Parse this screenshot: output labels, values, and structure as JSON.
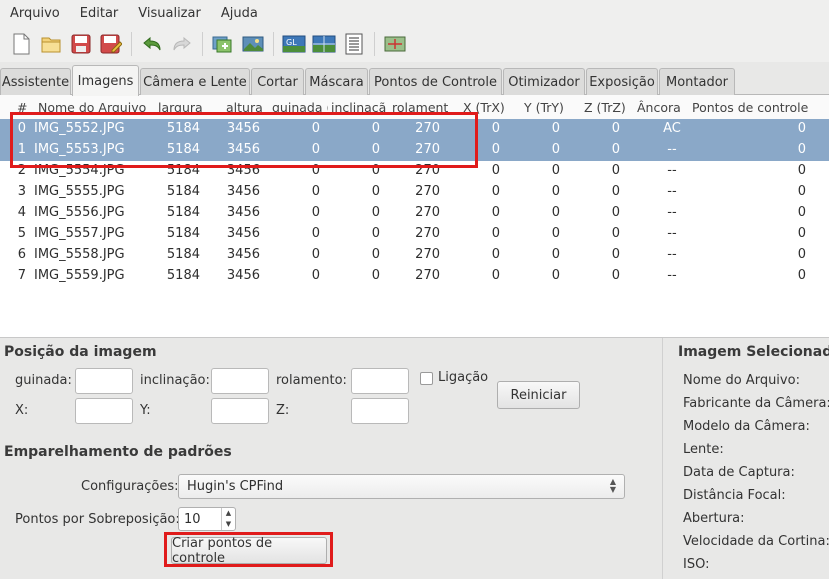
{
  "menu": [
    "Arquivo",
    "Editar",
    "Visualizar",
    "Ajuda"
  ],
  "toolbar_icons": [
    "new-file-icon",
    "open-folder-icon",
    "save-icon",
    "save-as-icon",
    "undo-icon",
    "redo-icon",
    "add-images-icon",
    "add-time-series-icon",
    "opengl-preview-icon",
    "fast-preview-icon",
    "list-view-icon",
    "control-point-editor-icon"
  ],
  "tabs": [
    "Assistente",
    "Imagens",
    "Câmera e Lente",
    "Cortar",
    "Máscara",
    "Pontos de Controle",
    "Otimizador",
    "Exposição",
    "Montador"
  ],
  "active_tab": "Imagens",
  "table": {
    "headers": [
      "#",
      "Nome do Arquivo",
      "largura",
      "altura",
      "guinada (",
      "inclinação",
      "rolament",
      "X (TrX)",
      "Y (TrY)",
      "Z (TrZ)",
      "Âncora",
      "Pontos de controle"
    ],
    "rows": [
      [
        "0",
        "IMG_5552.JPG",
        "5184",
        "3456",
        "0",
        "0",
        "270",
        "0",
        "0",
        "0",
        "AC",
        "0"
      ],
      [
        "1",
        "IMG_5553.JPG",
        "5184",
        "3456",
        "0",
        "0",
        "270",
        "0",
        "0",
        "0",
        "--",
        "0"
      ],
      [
        "2",
        "IMG_5554.JPG",
        "5184",
        "3456",
        "0",
        "0",
        "270",
        "0",
        "0",
        "0",
        "--",
        "0"
      ],
      [
        "3",
        "IMG_5555.JPG",
        "5184",
        "3456",
        "0",
        "0",
        "270",
        "0",
        "0",
        "0",
        "--",
        "0"
      ],
      [
        "4",
        "IMG_5556.JPG",
        "5184",
        "3456",
        "0",
        "0",
        "270",
        "0",
        "0",
        "0",
        "--",
        "0"
      ],
      [
        "5",
        "IMG_5557.JPG",
        "5184",
        "3456",
        "0",
        "0",
        "270",
        "0",
        "0",
        "0",
        "--",
        "0"
      ],
      [
        "6",
        "IMG_5558.JPG",
        "5184",
        "3456",
        "0",
        "0",
        "270",
        "0",
        "0",
        "0",
        "--",
        "0"
      ],
      [
        "7",
        "IMG_5559.JPG",
        "5184",
        "3456",
        "0",
        "0",
        "270",
        "0",
        "0",
        "0",
        "--",
        "0"
      ]
    ],
    "selected_rows": [
      0,
      1
    ]
  },
  "position": {
    "title": "Posição da imagem",
    "yaw_label": "guinada:",
    "pitch_label": "inclinação:",
    "roll_label": "rolamento:",
    "link_label": "Ligação",
    "x_label": "X:",
    "y_label": "Y:",
    "z_label": "Z:",
    "reset_button": "Reiniciar"
  },
  "matching": {
    "title": "Emparelhamento de padrões",
    "settings_label": "Configurações:",
    "settings_value": "Hugin's CPFind",
    "points_label": "Pontos por Sobreposição:",
    "points_value": "10",
    "create_button": "Criar pontos de controle"
  },
  "selected_image": {
    "title": "Imagem Selecionada",
    "fields": [
      "Nome do Arquivo:",
      "Fabricante da Câmera:",
      "Modelo da Câmera:",
      "Lente:",
      "Data de Captura:",
      "Distância Focal:",
      "Abertura:",
      "Velocidade da Cortina:",
      "ISO:"
    ]
  },
  "highlight_color": "#e01b1b",
  "selection_color": "#8aa8c8"
}
